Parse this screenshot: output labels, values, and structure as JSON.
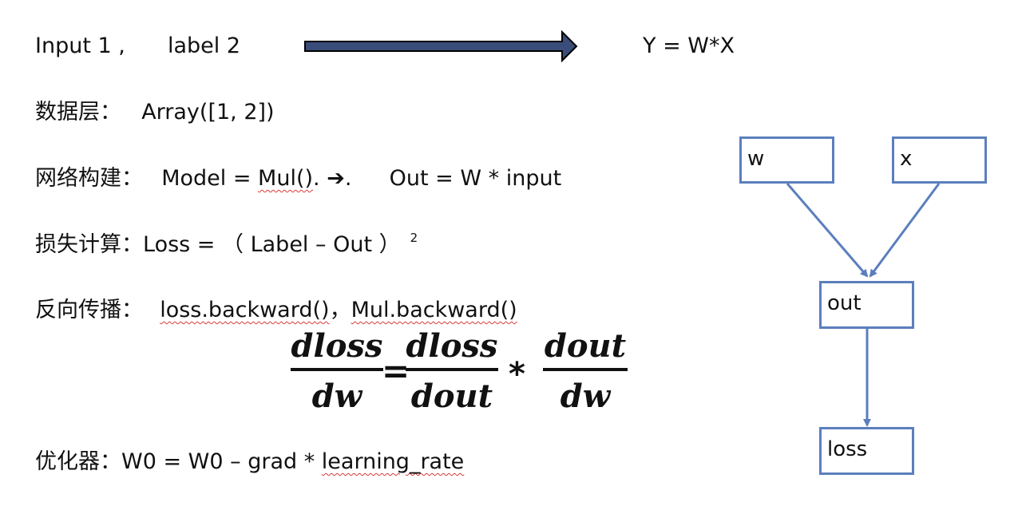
{
  "header": {
    "input_text": "Input 1 ,",
    "label_text": "label 2",
    "formula": "Y = W*X"
  },
  "steps": {
    "data_layer": {
      "label": "数据层：",
      "value": "Array([1, 2])"
    },
    "network": {
      "label": "网络构建：",
      "model_prefix": "Model = ",
      "model_call": "Mul()",
      "dot": ".",
      "arrow": "➔",
      "dot2": ".",
      "out": "Out = W * input"
    },
    "loss": {
      "label": "损失计算：",
      "value": "Loss = （ Label – Out ）",
      "exponent": "2"
    },
    "backprop": {
      "label": "反向传播：",
      "call1": "loss.backward()",
      "separator": "，",
      "call2": "Mul.backward()"
    },
    "optimizer": {
      "label": "优化器：",
      "prefix": "W0 = W0 – grad * ",
      "term": "learning_rate"
    }
  },
  "equation": {
    "lhs_num": "dloss",
    "lhs_den": "dw",
    "equals": "=",
    "mid_num": "dloss",
    "mid_den": "dout",
    "times": "*",
    "rhs_num": "dout",
    "rhs_den": "dw"
  },
  "graph": {
    "nodes": {
      "w": "w",
      "x": "x",
      "out": "out",
      "loss": "loss"
    },
    "edge_color": "#5b7fbd",
    "node_border_color": "#5b7fbd"
  },
  "colors": {
    "text": "#111111",
    "spellcheck_underline": "#d93a3a",
    "header_arrow_fill": "#3a4d7a"
  }
}
